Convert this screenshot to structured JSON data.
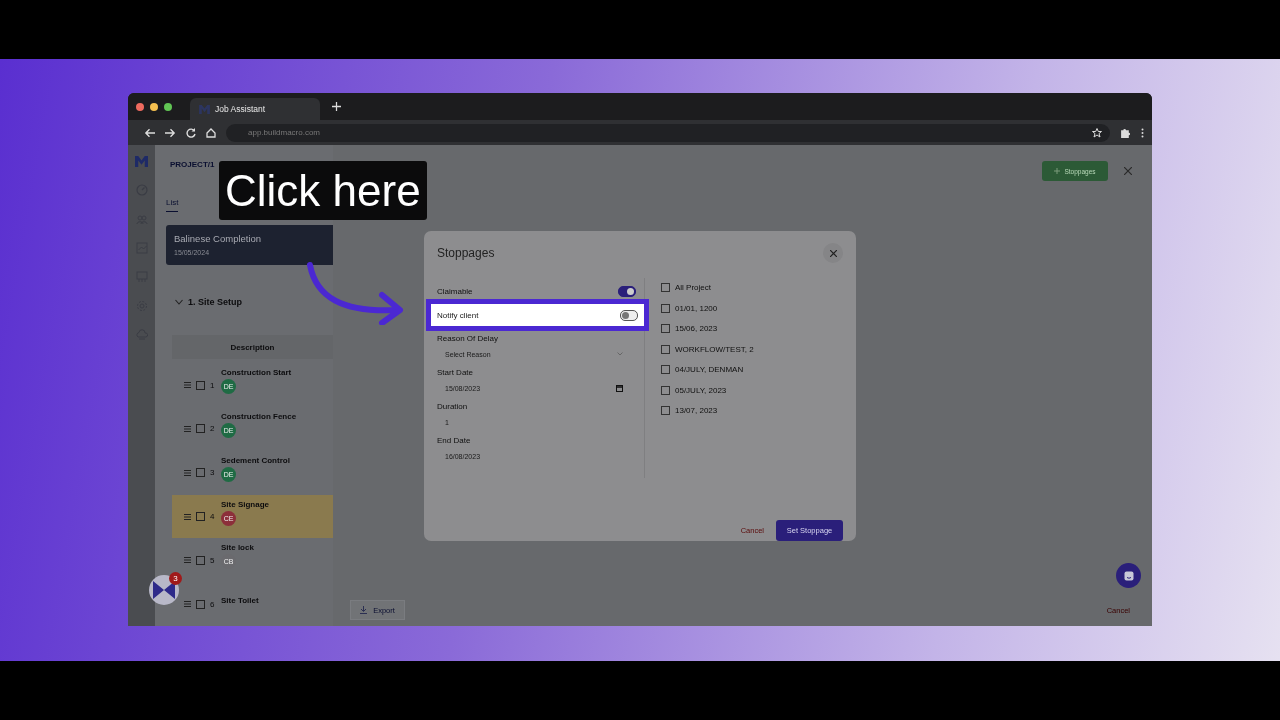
{
  "browser": {
    "tab_title": "Job Assistant",
    "url": "app.buildmacro.com"
  },
  "app": {
    "breadcrumb": "PROJECT/1",
    "view_tabs": [
      {
        "label": "List",
        "selected": true
      }
    ],
    "stage_card": {
      "title": "Balinese Completion",
      "date": "15/05/2024"
    },
    "section": {
      "title": "1. Site Setup",
      "expanded": true
    },
    "table_header": "Description",
    "tasks": [
      {
        "number": "1",
        "name": "Construction Start",
        "assignee": "DE",
        "color": "#1f6b44",
        "highlighted": false,
        "checked": false
      },
      {
        "number": "2",
        "name": "Construction Fence",
        "assignee": "DE",
        "color": "#1f6b44",
        "highlighted": false,
        "checked": false
      },
      {
        "number": "3",
        "name": "Sedement Control",
        "assignee": "DE",
        "color": "#1f6b44",
        "highlighted": false,
        "checked": false
      },
      {
        "number": "4",
        "name": "Site Signage",
        "assignee": "CE",
        "color": "#8c2f3a",
        "highlighted": true,
        "checked": false
      },
      {
        "number": "5",
        "name": "Site lock",
        "assignee": "CB",
        "color": "#6a6a6e",
        "highlighted": false,
        "checked": false
      },
      {
        "number": "6",
        "name": "Site Toilet",
        "checked": false,
        "highlighted": false
      }
    ],
    "stoppages_button": "Stoppages",
    "export_button": "Export",
    "cancel_link": "Cancel",
    "notification_count": "3"
  },
  "modal": {
    "title": "Stoppages",
    "toggles": [
      {
        "label": "Claimable",
        "on": true,
        "highlighted": false
      },
      {
        "label": "Notify client",
        "on": false,
        "highlighted": true
      }
    ],
    "fields": [
      {
        "label": "Reason Of Delay",
        "kind": "select",
        "placeholder": "Select Reason"
      },
      {
        "label": "Start Date",
        "kind": "date",
        "value": "15/08/2023"
      },
      {
        "label": "Duration",
        "kind": "text",
        "value": "1"
      },
      {
        "label": "End Date",
        "kind": "text",
        "value": "16/08/2023"
      }
    ],
    "stages": [
      {
        "label": "All Project",
        "checked": false
      },
      {
        "label": "01/01, 1200",
        "checked": false
      },
      {
        "label": "15/06, 2023",
        "checked": false
      },
      {
        "label": "WORKFLOW/TEST, 2",
        "checked": false
      },
      {
        "label": "04/JULY, DENMAN",
        "checked": false
      },
      {
        "label": "05/JULY, 2023",
        "checked": false
      },
      {
        "label": "13/07, 2023",
        "checked": false
      }
    ],
    "cancel": "Cancel",
    "submit": "Set Stoppage"
  },
  "caption": "Click here"
}
